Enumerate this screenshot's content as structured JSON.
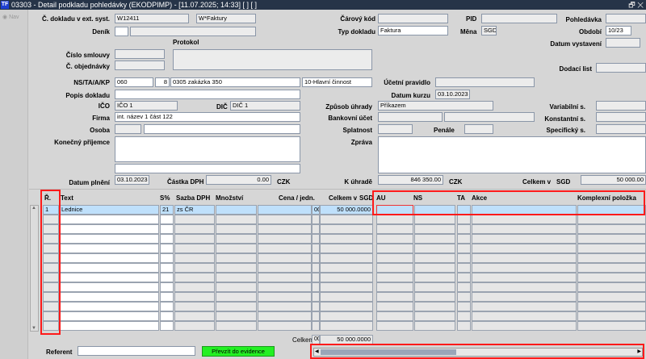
{
  "window": {
    "title": "03303 - Detail podkladu pohledávky (EKODPIMP) - [11.07.2025; 14:33]  [ ]  [ ]",
    "logo": "TF",
    "controls": "🗗 ✕"
  },
  "nav": {
    "label": "Nav"
  },
  "form": {
    "ext_doc_label": "Č. dokladu v ext. syst.",
    "ext_doc": "W12411",
    "ext_doc2": "W*Faktury",
    "denik_label": "Deník",
    "protokol_label": "Protokol",
    "smlouva_label": "Číslo smlouvy",
    "objednavka_label": "Č. objednávky",
    "ns_label": "NS/TA/A/KP",
    "ns": "060",
    "ta": "8",
    "akce": "0305 zakázka 350",
    "kp": "10-Hlavní činnost",
    "popis_label": "Popis dokladu",
    "ico_label": "IČO",
    "ico": "IČO 1",
    "dic_label": "DIČ",
    "dic": "DIČ 1",
    "firma_label": "Firma",
    "firma": "int. název 1 část 122",
    "osoba_label": "Osoba",
    "prijemce_label": "Konečný příjemce",
    "datum_plneni_label": "Datum plnění",
    "datum_plneni": "03.10.2023",
    "castka_dph_label": "Částka DPH",
    "castka_dph": "0.00",
    "czk1": "CZK",
    "carovy_label": "Čárový kód",
    "typ_label": "Typ dokladu",
    "typ": "Faktura",
    "pid_label": "PID",
    "mena_label": "Měna",
    "mena": "SGD",
    "pohledavka_label": "Pohledávka",
    "obdobi_label": "Období",
    "obdobi": "10/23",
    "datum_vyst_label": "Datum vystavení",
    "dodaci_label": "Dodací list",
    "ucetni_label": "Účetní pravidlo",
    "datum_kurzu_label": "Datum kurzu",
    "datum_kurzu": "03.10.2023",
    "zpusob_label": "Způsob úhrady",
    "zpusob": "Příkazem",
    "bank_label": "Bankovní účet",
    "splatnost_label": "Splatnost",
    "penale_label": "Penále",
    "var_label": "Variabilní s.",
    "konst_label": "Konstantní s.",
    "spec_label": "Specifický s.",
    "zprava_label": "Zpráva",
    "k_uhrade_label": "K úhradě",
    "k_uhrade": "846 350.00",
    "czk2": "CZK",
    "celkem_label": "Celkem v",
    "celkem_mena": "SGD",
    "celkem": "50 000.00"
  },
  "table": {
    "headers": {
      "r": "Ř.",
      "text": "Text",
      "s": "S%",
      "sazba": "Sazba DPH",
      "mnozstvi": "Množství",
      "cena": "Cena / jedn.",
      "celkem": "Celkem v",
      "celkem_mena": "SGD",
      "au": "AU",
      "ns": "NS",
      "ta": "TA",
      "akce": "Akce",
      "komplex": "Komplexní položka"
    },
    "rows": [
      {
        "r": "1",
        "text": "Lednice",
        "s": "21",
        "sazba": "zs ČR",
        "cena_tail": "00",
        "celkem": "50 000.0000"
      }
    ],
    "total_label": "Celkem",
    "total_tail": "00",
    "total": "50 000.0000"
  },
  "footer": {
    "referent_label": "Referent",
    "prevzit": "Převzít do evidence"
  }
}
